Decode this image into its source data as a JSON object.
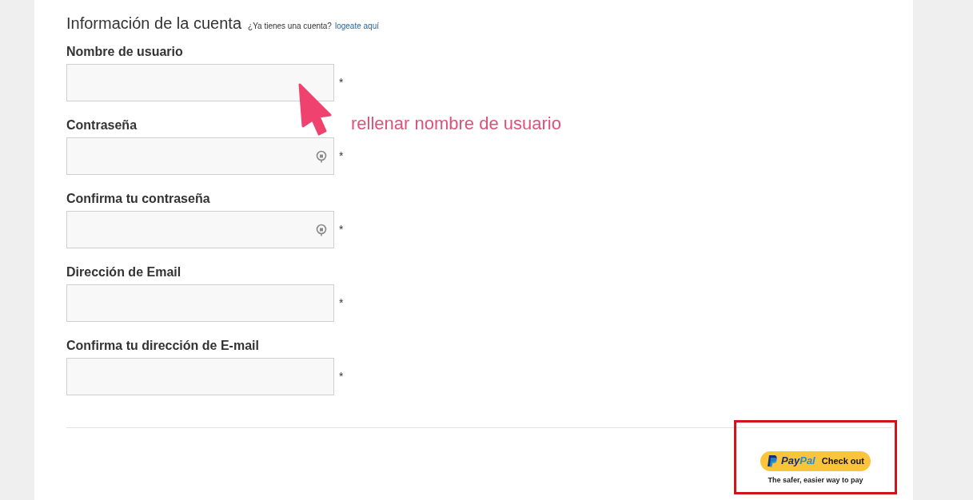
{
  "section": {
    "title": "Información de la cuenta",
    "prompt": "¿Ya tienes una cuenta?",
    "login_link": "logeate aquí"
  },
  "fields": [
    {
      "label": "Nombre de usuario",
      "kind": "text",
      "required_mark": "*"
    },
    {
      "label": "Contraseña",
      "kind": "password",
      "required_mark": "*"
    },
    {
      "label": "Confirma tu contraseña",
      "kind": "password",
      "required_mark": "*"
    },
    {
      "label": "Dirección de Email",
      "kind": "text",
      "required_mark": "*"
    },
    {
      "label": "Confirma tu dirección de E-mail",
      "kind": "text",
      "required_mark": "*"
    }
  ],
  "annotation": {
    "text": "rellenar nombre de usuario"
  },
  "checkout": {
    "brand_first": "Pay",
    "brand_second": "Pal",
    "button_label": "Check out",
    "tagline": "The safer, easier way to pay"
  }
}
